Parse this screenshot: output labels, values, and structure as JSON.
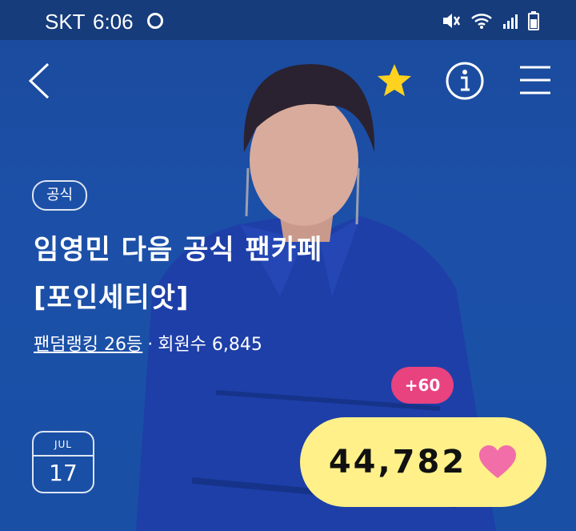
{
  "status_bar": {
    "carrier": "SKT",
    "time": "6:06"
  },
  "cafe": {
    "badge": "공식",
    "title": "임영민 다음 공식 팬카페 [포인세티앗]",
    "ranking": "팬덤랭킹 26등",
    "separator": "·",
    "members": "회원수 6,845"
  },
  "date": {
    "month": "JUL",
    "day": "17"
  },
  "hearts": {
    "increment": "+60",
    "count": "44,782"
  },
  "colors": {
    "background": "#1c50a8",
    "status_bar": "#163c7c",
    "star": "#ffd21f",
    "heart_pill": "#fff08a",
    "heart": "#f26ea8",
    "plus_badge": "#e8427f"
  }
}
